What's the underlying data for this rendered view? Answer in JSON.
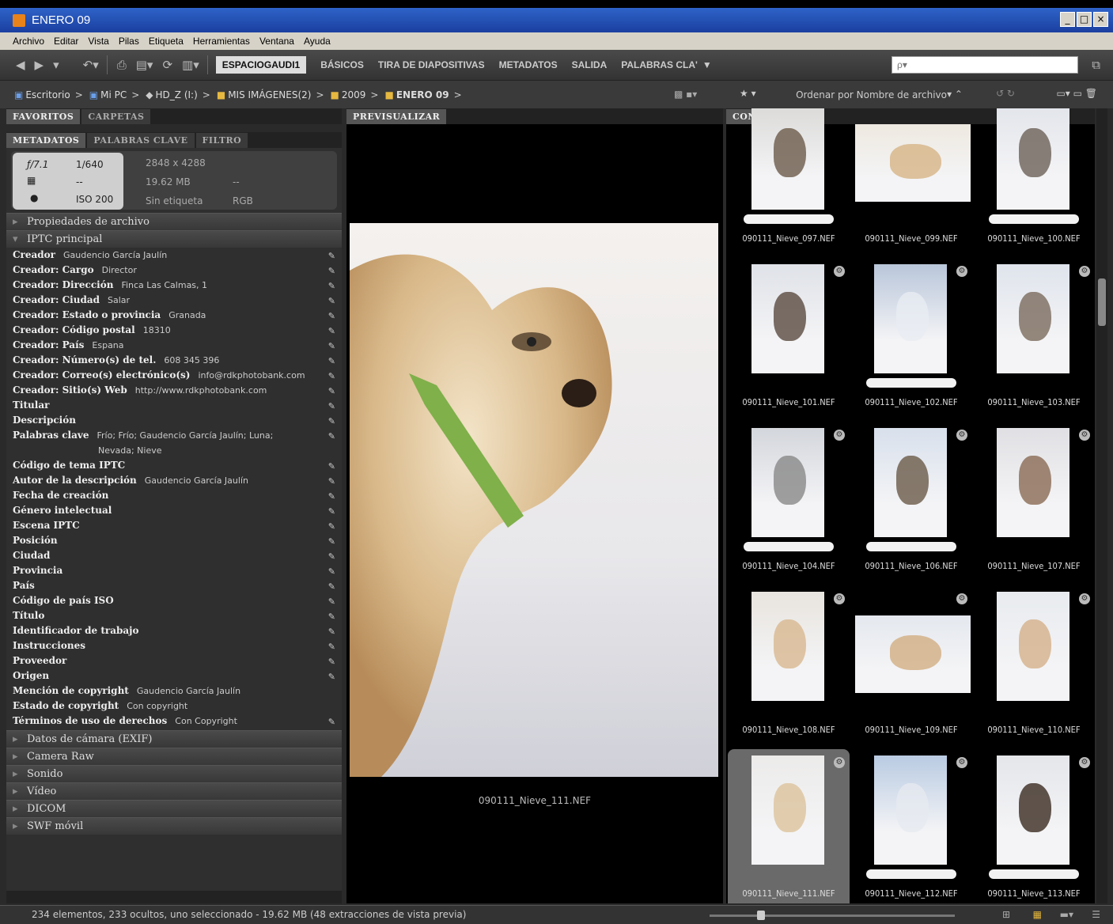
{
  "window": {
    "title": "ENERO 09"
  },
  "menu": [
    "Archivo",
    "Editar",
    "Vista",
    "Pilas",
    "Etiqueta",
    "Herramientas",
    "Ventana",
    "Ayuda"
  ],
  "workspaces": [
    "ESPACIOGAUDI1",
    "BÁSICOS",
    "TIRA DE DIAPOSITIVAS",
    "METADATOS",
    "SALIDA",
    "PALABRAS CLA'"
  ],
  "search": {
    "placeholder": "ρ▾"
  },
  "breadcrumb": [
    "Escritorio",
    "Mi PC",
    "HD_Z (I:)",
    "MIS IMÁGENES(2)",
    "2009",
    "ENERO 09"
  ],
  "sort_label": "Ordenar por Nombre de archivo",
  "left_tabs_top": [
    "FAVORITOS",
    "CARPETAS"
  ],
  "left_tabs": [
    "METADATOS",
    "PALABRAS CLAVE",
    "FILTRO"
  ],
  "camera": {
    "aperture": "ƒ/7.1",
    "shutter": "1/640",
    "dash1": "--",
    "iso": "ISO 200",
    "dimensions": "2848 x 4288",
    "size": "19.62 MB",
    "dash2": "--",
    "label": "Sin etiqueta",
    "mode": "RGB"
  },
  "sections_top": [
    "Propiedades de archivo",
    "IPTC principal"
  ],
  "iptc": [
    {
      "k": "Creador",
      "v": "Gaudencio García Jaulín"
    },
    {
      "k": "Creador: Cargo",
      "v": "Director"
    },
    {
      "k": "Creador: Dirección",
      "v": "Finca Las Calmas, 1"
    },
    {
      "k": "Creador: Ciudad",
      "v": "Salar"
    },
    {
      "k": "Creador: Estado o provincia",
      "v": "Granada"
    },
    {
      "k": "Creador: Código postal",
      "v": "18310"
    },
    {
      "k": "Creador: País",
      "v": "Espana"
    },
    {
      "k": "Creador: Número(s) de tel.",
      "v": "608 345 396"
    },
    {
      "k": "Creador: Correo(s) electrónico(s)",
      "v": "info@rdkphotobank.com"
    },
    {
      "k": "Creador: Sitio(s) Web",
      "v": "http://www.rdkphotobank.com"
    },
    {
      "k": "Titular",
      "v": ""
    },
    {
      "k": "Descripción",
      "v": ""
    },
    {
      "k": "Palabras clave",
      "v": "Frío; Frío; Gaudencio García Jaulín; Luna;"
    },
    {
      "k": "",
      "v": "Nevada; Nieve"
    },
    {
      "k": "Código de tema IPTC",
      "v": ""
    },
    {
      "k": "Autor de la descripción",
      "v": "Gaudencio García Jaulín"
    },
    {
      "k": "Fecha de creación",
      "v": ""
    },
    {
      "k": "Género intelectual",
      "v": ""
    },
    {
      "k": "Escena IPTC",
      "v": ""
    },
    {
      "k": "Posición",
      "v": ""
    },
    {
      "k": "Ciudad",
      "v": ""
    },
    {
      "k": "Provincia",
      "v": ""
    },
    {
      "k": "País",
      "v": ""
    },
    {
      "k": "Código de país ISO",
      "v": ""
    },
    {
      "k": "Título",
      "v": ""
    },
    {
      "k": "Identificador de trabajo",
      "v": ""
    },
    {
      "k": "Instrucciones",
      "v": ""
    },
    {
      "k": "Proveedor",
      "v": ""
    },
    {
      "k": "Origen",
      "v": ""
    },
    {
      "k": "Mención de copyright",
      "v": "Gaudencio García Jaulín"
    },
    {
      "k": "Estado de copyright",
      "v": "Con copyright"
    },
    {
      "k": "Términos de uso de derechos",
      "v": "Con Copyright"
    }
  ],
  "sections_bottom": [
    "Datos de cámara (EXIF)",
    "Camera Raw",
    "Sonido",
    "Vídeo",
    "DICOM",
    "SWF móvil"
  ],
  "preview": {
    "tab": "PREVISUALIZAR",
    "caption": "090111_Nieve_111.NEF"
  },
  "content": {
    "tab": "CONTENIDO",
    "files": [
      "090111_Nieve_097.NEF",
      "090111_Nieve_099.NEF",
      "090111_Nieve_100.NEF",
      "090111_Nieve_101.NEF",
      "090111_Nieve_102.NEF",
      "090111_Nieve_103.NEF",
      "090111_Nieve_104.NEF",
      "090111_Nieve_106.NEF",
      "090111_Nieve_107.NEF",
      "090111_Nieve_108.NEF",
      "090111_Nieve_109.NEF",
      "090111_Nieve_110.NEF",
      "090111_Nieve_111.NEF",
      "090111_Nieve_112.NEF",
      "090111_Nieve_113.NEF"
    ]
  },
  "status": "234 elementos, 233 ocultos, uno seleccionado - 19.62 MB (48 extracciones de vista previa)"
}
